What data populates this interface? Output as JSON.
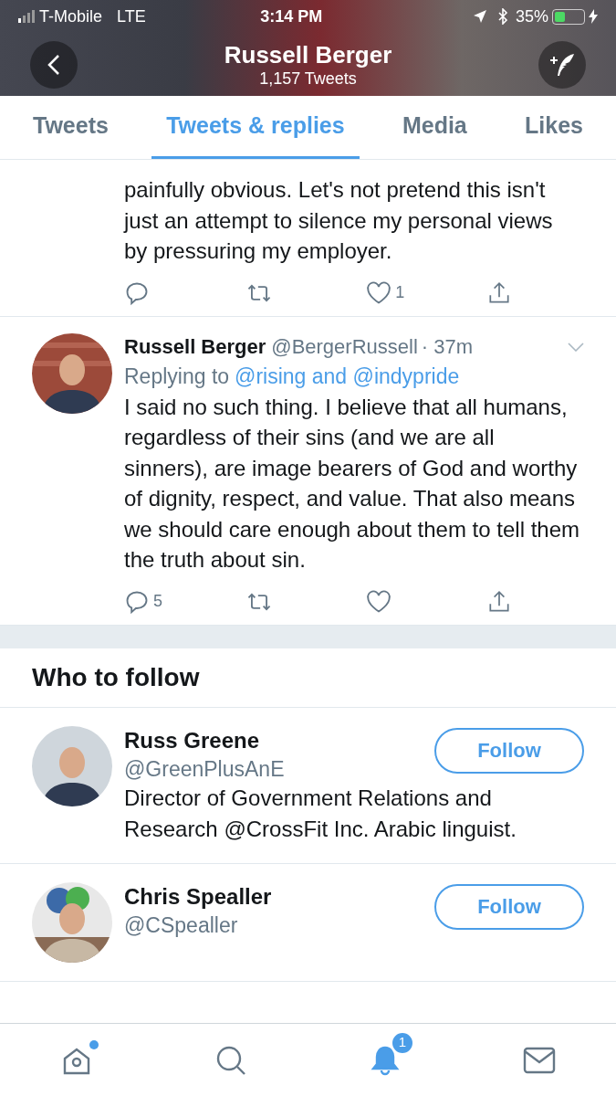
{
  "status_bar": {
    "carrier": "T-Mobile",
    "network": "LTE",
    "time": "3:14 PM",
    "battery": "35%"
  },
  "header": {
    "title": "Russell Berger",
    "subtitle": "1,157 Tweets"
  },
  "tabs": [
    {
      "label": "Tweets",
      "selected": false
    },
    {
      "label": "Tweets & replies",
      "selected": true
    },
    {
      "label": "Media",
      "selected": false
    },
    {
      "label": "Likes",
      "selected": false
    }
  ],
  "tweets": [
    {
      "text": "painfully obvious. Let's not pretend this isn't just an attempt to silence my personal views by pressuring my employer.",
      "like_count": "1"
    },
    {
      "author": "Russell Berger",
      "handle": "@BergerRussell",
      "time": "· 37m",
      "reply_prefix": "Replying to",
      "reply_to": "@rising and @indypride",
      "text": "I said no such thing. I believe that all humans, regardless of their sins (and we are all sinners), are image bearers of God and worthy of dignity, respect, and value. That also means we should care enough about them to tell them the truth about sin.",
      "reply_count": "5"
    }
  ],
  "who_to_follow": {
    "title": "Who to follow",
    "users": [
      {
        "name": "Russ Greene",
        "handle": "@GreenPlusAnE",
        "bio": "Director of Government Relations and Research @CrossFit Inc. Arabic linguist.",
        "button": "Follow"
      },
      {
        "name": "Chris Spealler",
        "handle": "@CSpealler",
        "button": "Follow"
      }
    ]
  },
  "bottom_nav": [
    {
      "kind": "home",
      "selected": false,
      "dot": true
    },
    {
      "kind": "search",
      "selected": false
    },
    {
      "kind": "notifications",
      "selected": true,
      "badge": "1"
    },
    {
      "kind": "messages",
      "selected": false
    }
  ]
}
